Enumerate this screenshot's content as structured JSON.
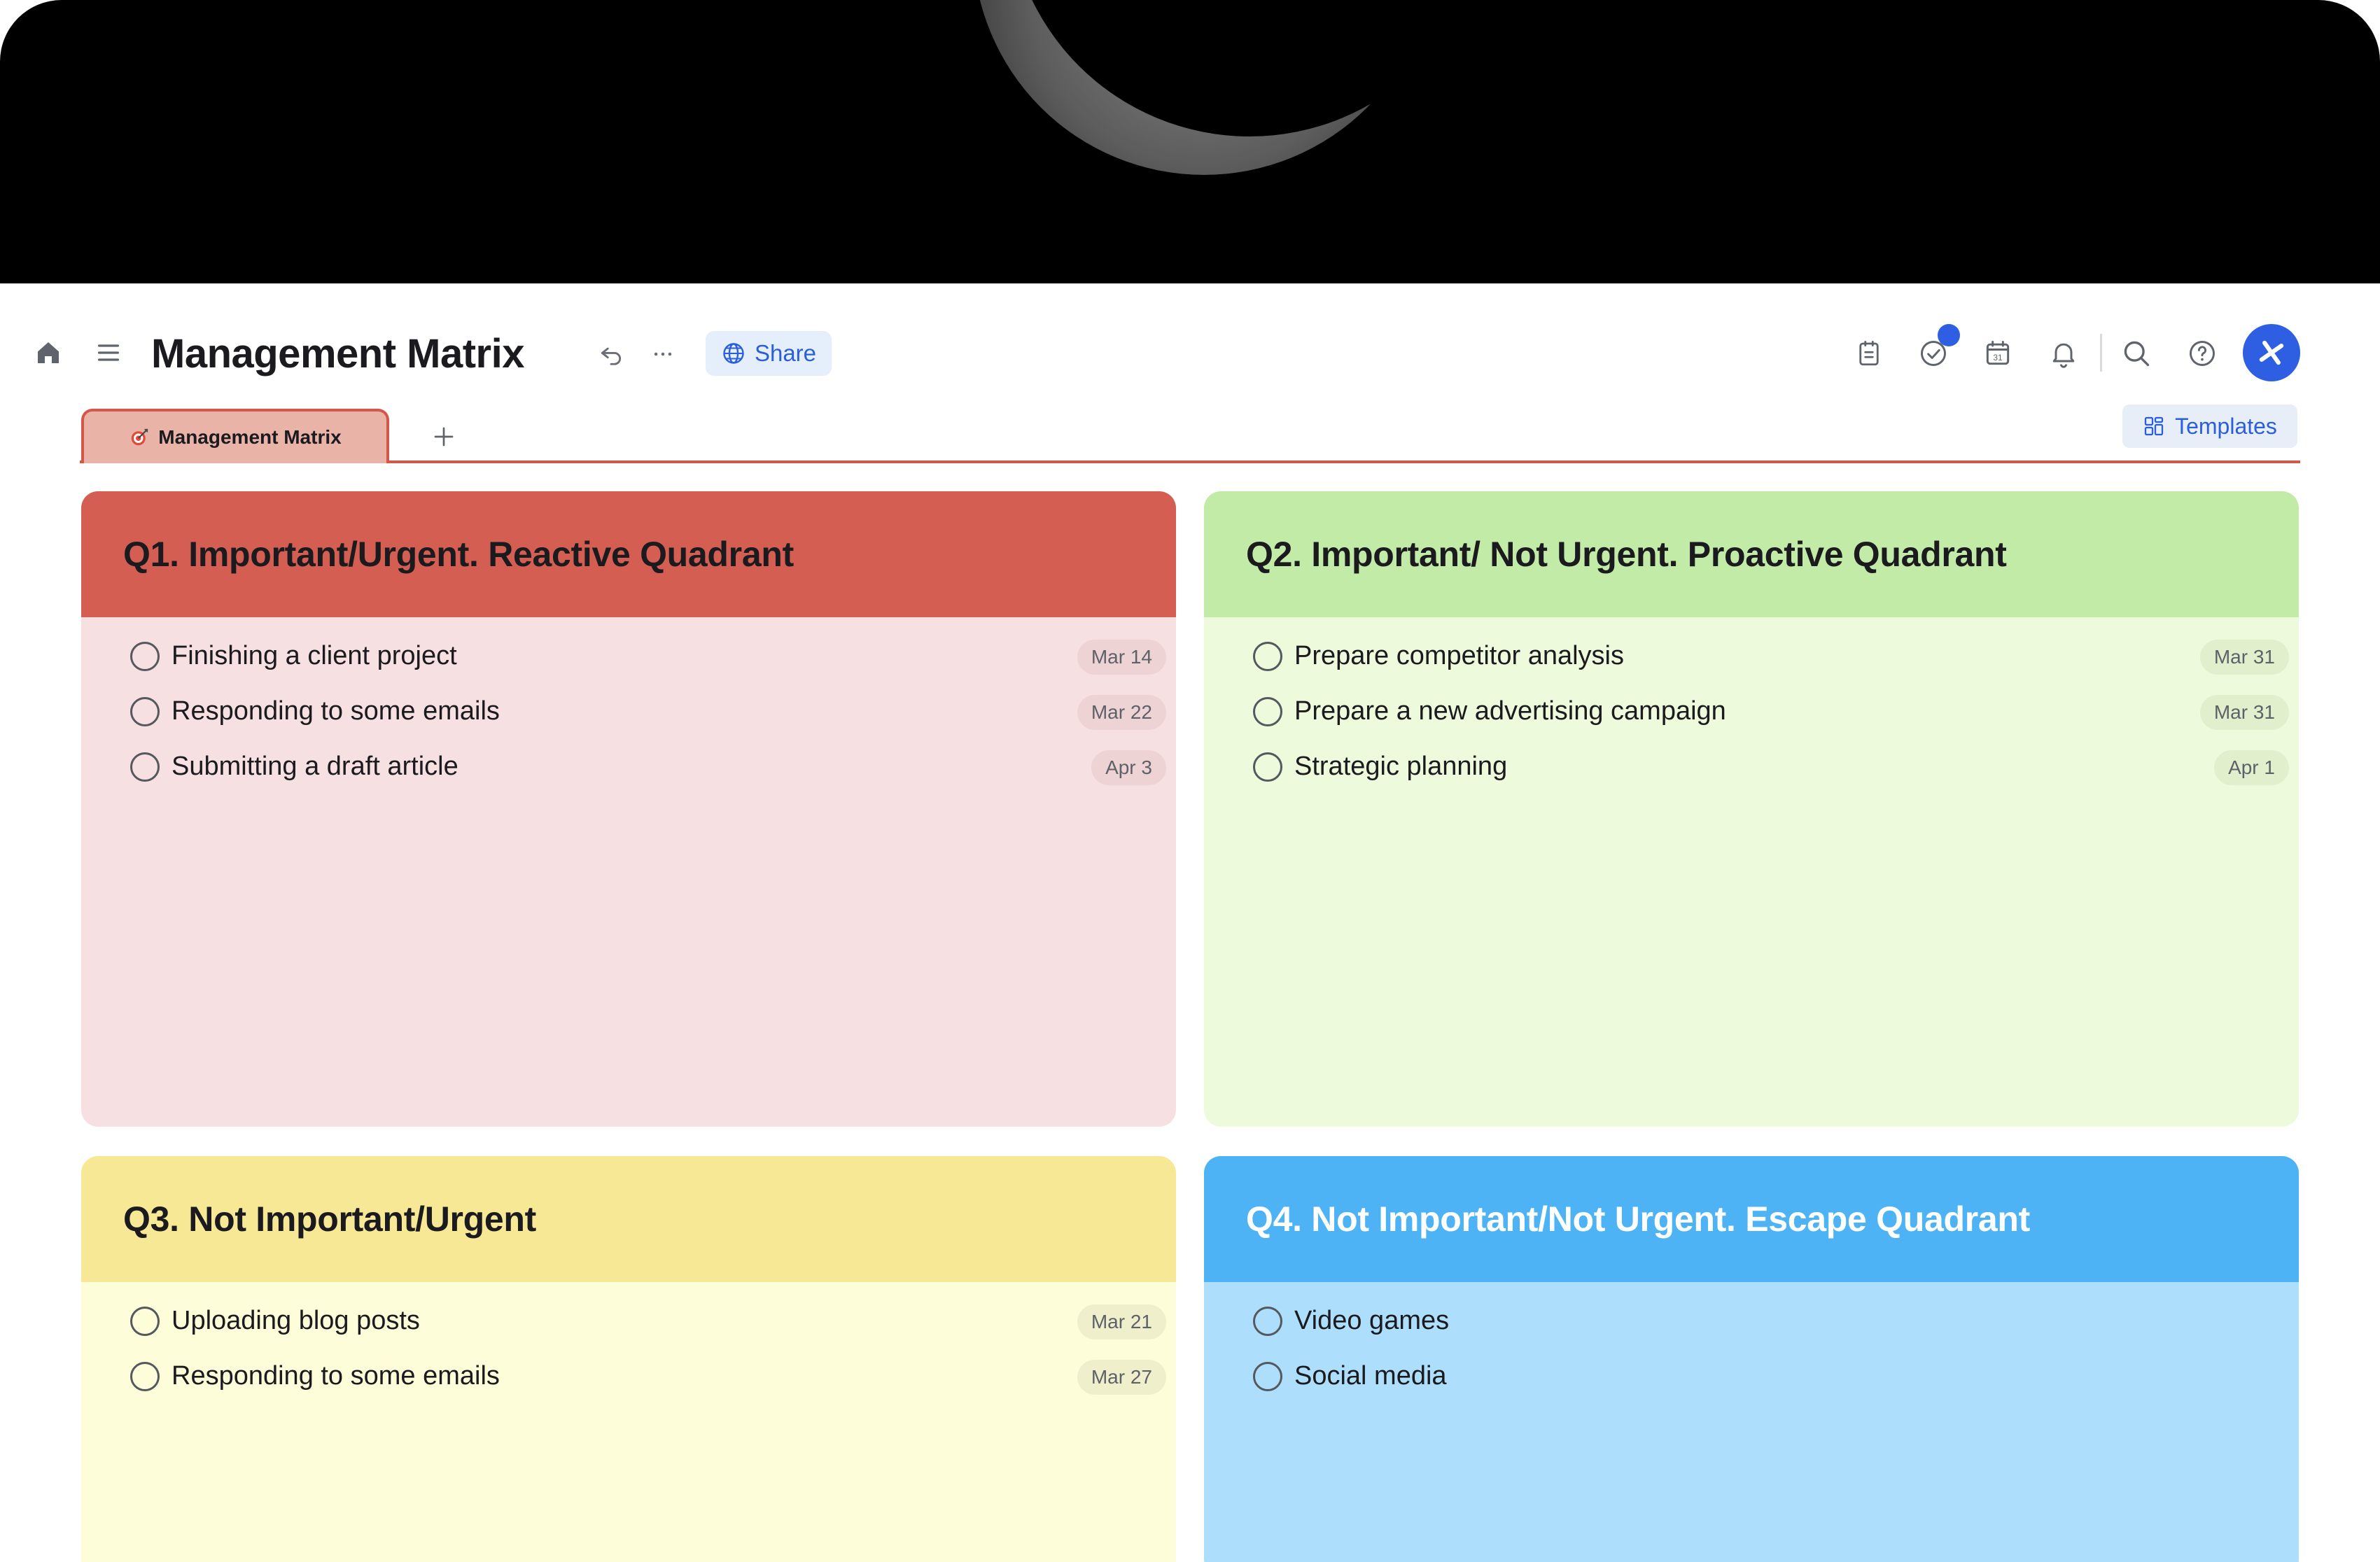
{
  "header": {
    "title": "Management Matrix",
    "share_label": "Share",
    "icons": [
      "home-icon",
      "menu-icon",
      "undo-icon",
      "more-icon",
      "globe-icon",
      "notes-icon",
      "tasks-check-icon",
      "calendar-icon",
      "bell-icon",
      "search-icon",
      "help-icon",
      "avatar-logo-icon"
    ],
    "calendar_day": "31",
    "notification_dot_color": "#2e5fe3"
  },
  "tabs": {
    "active_label": "Management Matrix",
    "add_label": "+",
    "templates_label": "Templates"
  },
  "quadrants": [
    {
      "title": "Q1. Important/Urgent. Reactive Quadrant",
      "color": "#d35e51",
      "tasks": [
        {
          "label": "Finishing a client project",
          "due": "Mar 14"
        },
        {
          "label": "Responding to some emails",
          "due": "Mar 22"
        },
        {
          "label": "Submitting a draft article",
          "due": "Apr 3"
        }
      ]
    },
    {
      "title": "Q2. Important/ Not Urgent. Proactive Quadrant",
      "color": "#c2eba7",
      "tasks": [
        {
          "label": "Prepare competitor analysis",
          "due": "Mar 31"
        },
        {
          "label": "Prepare a new advertising campaign",
          "due": "Mar 31"
        },
        {
          "label": "Strategic planning",
          "due": "Apr 1"
        }
      ]
    },
    {
      "title": "Q3. Not Important/Urgent",
      "color": "#f7e895",
      "tasks": [
        {
          "label": "Uploading blog posts",
          "due": "Mar 21"
        },
        {
          "label": "Responding to some emails",
          "due": "Mar 27"
        }
      ]
    },
    {
      "title": "Q4. Not Important/Not Urgent. Escape Quadrant",
      "color": "#4db3f5",
      "tasks": [
        {
          "label": "Video games",
          "due": ""
        },
        {
          "label": "Social media",
          "due": ""
        }
      ]
    }
  ]
}
